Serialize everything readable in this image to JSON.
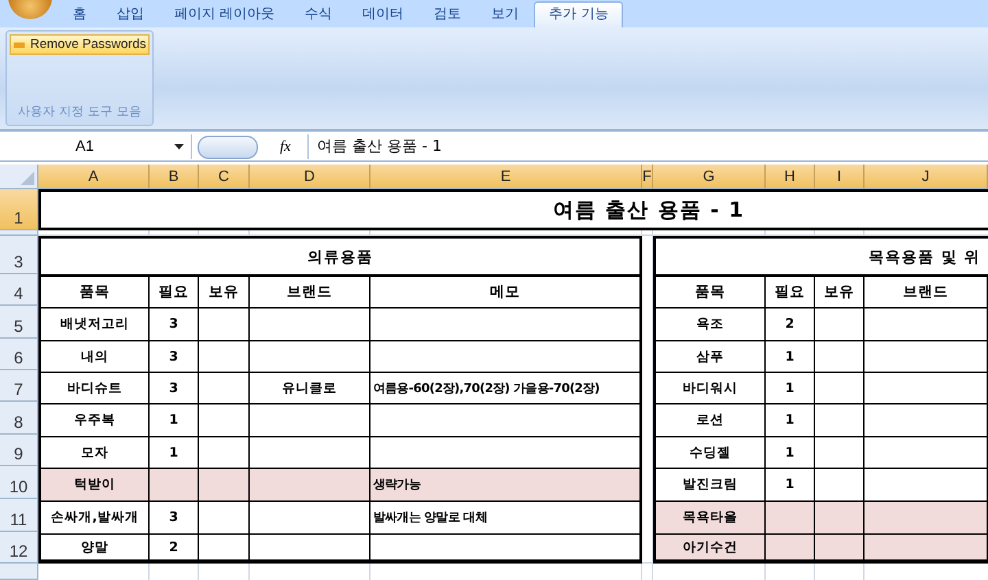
{
  "ribbon_tabs": [
    {
      "label": "홈",
      "selected": false
    },
    {
      "label": "삽입",
      "selected": false
    },
    {
      "label": "페이지 레이아웃",
      "selected": false
    },
    {
      "label": "수식",
      "selected": false
    },
    {
      "label": "데이터",
      "selected": false
    },
    {
      "label": "검토",
      "selected": false
    },
    {
      "label": "보기",
      "selected": false
    },
    {
      "label": "추가 기능",
      "selected": true
    }
  ],
  "ribbon": {
    "button": "Remove Passwords",
    "group_label": "사용자 지정 도구 모음"
  },
  "formula_bar": {
    "name_box": "A1",
    "function_label": "fx",
    "formula": "여름 출산 용품 - 1"
  },
  "sheet": {
    "columns": [
      {
        "label": "A",
        "selected": true
      },
      {
        "label": "B",
        "selected": true
      },
      {
        "label": "C",
        "selected": true
      },
      {
        "label": "D",
        "selected": true
      },
      {
        "label": "E",
        "selected": true
      },
      {
        "label": "F",
        "selected": true
      },
      {
        "label": "G",
        "selected": true
      },
      {
        "label": "H",
        "selected": true
      },
      {
        "label": "I",
        "selected": true
      },
      {
        "label": "J",
        "selected": true
      }
    ],
    "rows": [
      {
        "label": "1",
        "selected": true
      },
      {
        "label": "3",
        "selected": false
      },
      {
        "label": "4",
        "selected": false
      },
      {
        "label": "5",
        "selected": false
      },
      {
        "label": "6",
        "selected": false
      },
      {
        "label": "7",
        "selected": false
      },
      {
        "label": "8",
        "selected": false
      },
      {
        "label": "9",
        "selected": false
      },
      {
        "label": "10",
        "selected": false
      },
      {
        "label": "11",
        "selected": false
      },
      {
        "label": "12",
        "selected": false
      }
    ],
    "title": "여름 출산 용품 - 1",
    "tables": [
      {
        "title": "의류용품",
        "headers": [
          "품목",
          "필요",
          "보유",
          "브랜드",
          "메모"
        ],
        "rows": [
          {
            "item": "배냇저고리",
            "need": "3",
            "highlighted": false
          },
          {
            "item": "내의",
            "need": "3",
            "highlighted": false
          },
          {
            "item": "바디슈트",
            "need": "3",
            "brand": "유니클로",
            "memo": "여름용-60(2장),70(2장) 가을용-70(2장)",
            "highlighted": false
          },
          {
            "item": "우주복",
            "need": "1",
            "highlighted": false
          },
          {
            "item": "모자",
            "need": "1",
            "highlighted": false
          },
          {
            "item": "턱받이",
            "memo": "생략가능",
            "highlighted": true
          },
          {
            "item": "손싸개,발싸개",
            "need": "3",
            "memo": "발싸개는 양말로 대체",
            "highlighted": false
          },
          {
            "item": "양말",
            "need": "2",
            "highlighted": false
          }
        ]
      },
      {
        "title": "목욕용품 및 위",
        "headers": [
          "품목",
          "필요",
          "보유",
          "브랜드"
        ],
        "rows": [
          {
            "item": "욕조",
            "need": "2",
            "highlighted": false
          },
          {
            "item": "삼푸",
            "need": "1",
            "highlighted": false
          },
          {
            "item": "바디워시",
            "need": "1",
            "highlighted": false
          },
          {
            "item": "로션",
            "need": "1",
            "highlighted": false
          },
          {
            "item": "수딩젤",
            "need": "1",
            "highlighted": false
          },
          {
            "item": "발진크림",
            "need": "1",
            "highlighted": false
          },
          {
            "item": "목욕타올",
            "highlighted": true
          },
          {
            "item": "아기수건",
            "highlighted": true
          }
        ]
      }
    ]
  }
}
